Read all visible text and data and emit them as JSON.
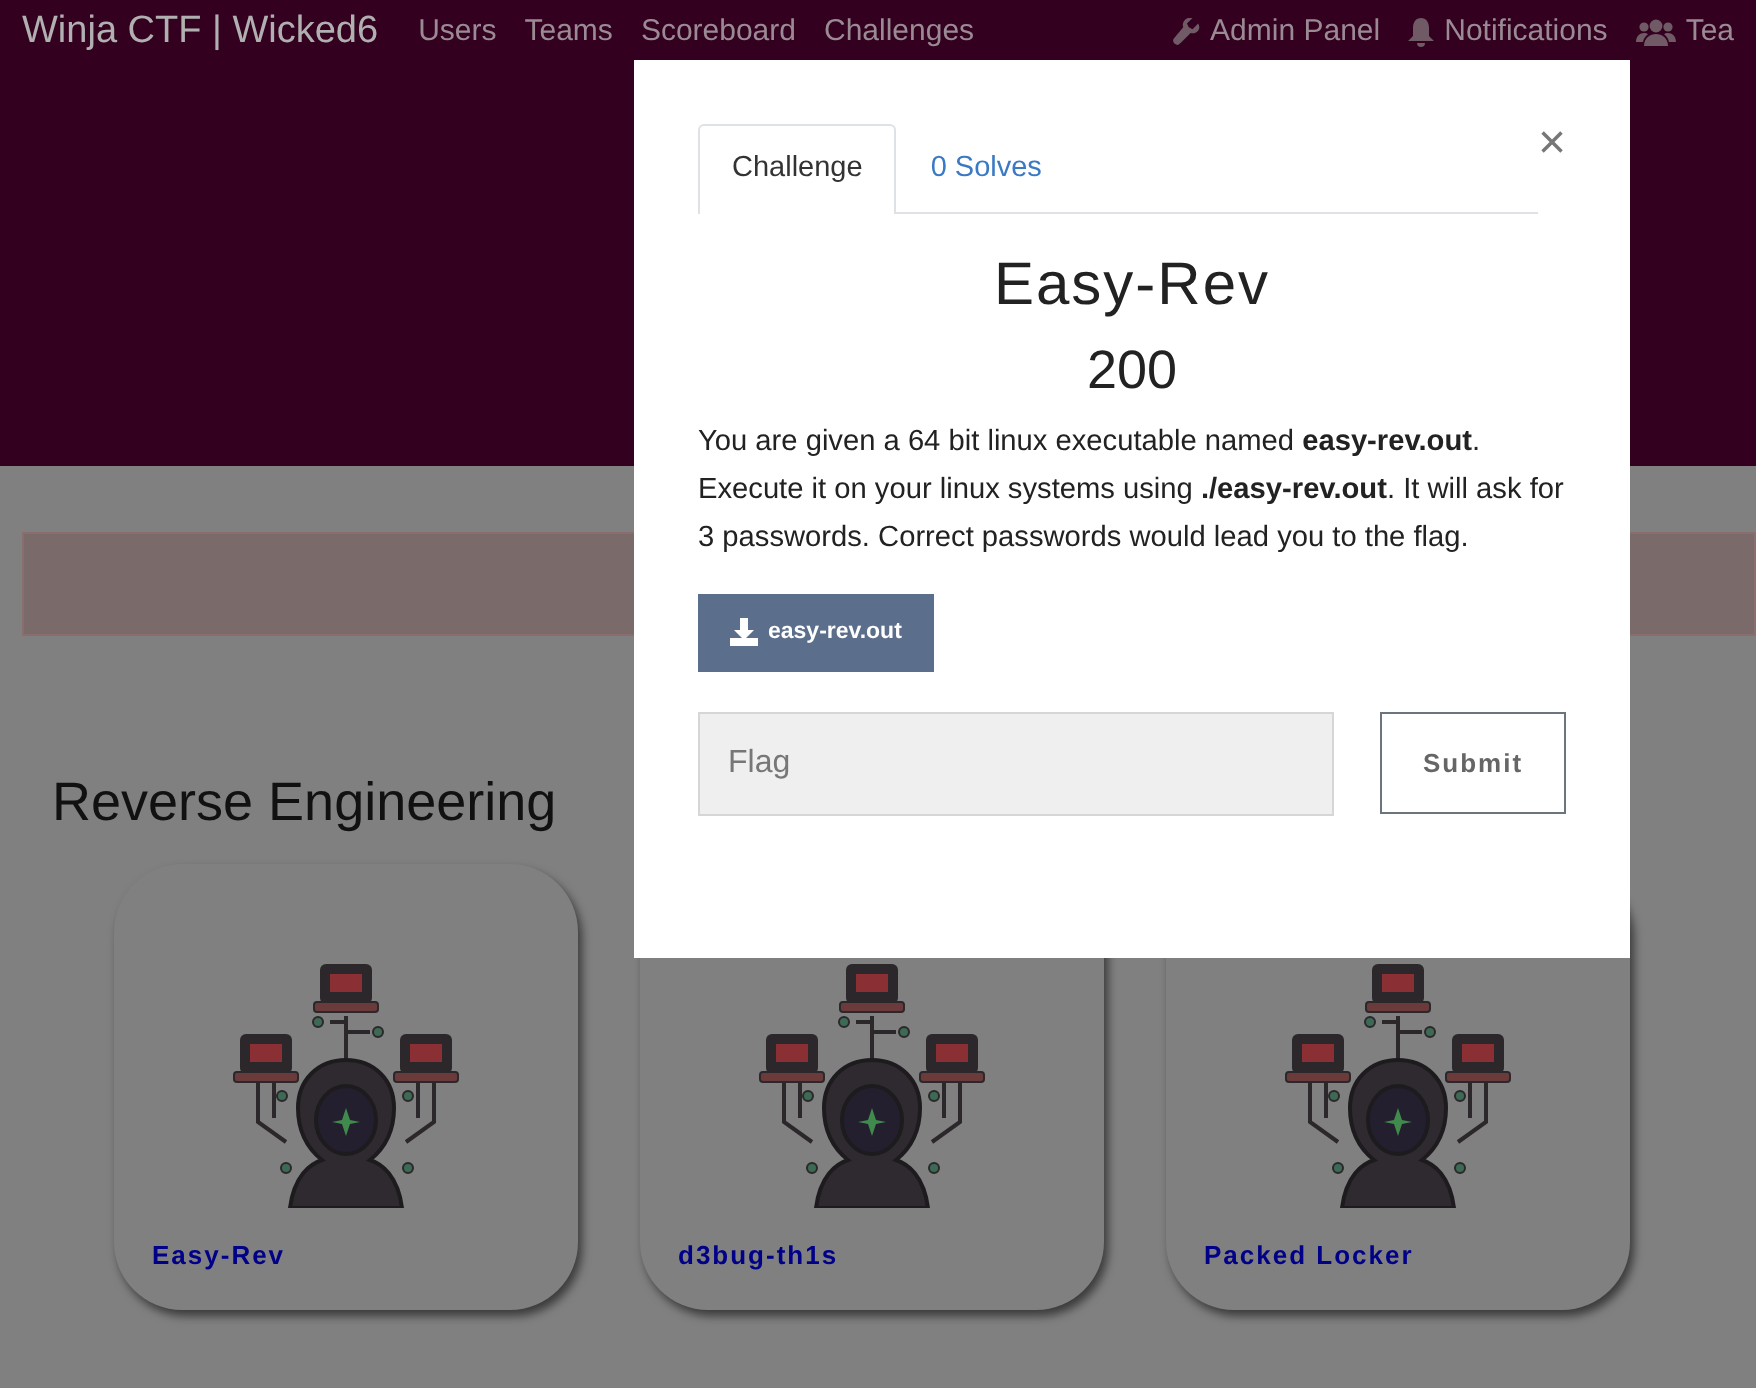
{
  "navbar": {
    "brand": "Winja CTF | Wicked6",
    "links": [
      {
        "label": "Users"
      },
      {
        "label": "Teams"
      },
      {
        "label": "Scoreboard"
      },
      {
        "label": "Challenges"
      }
    ],
    "right_links": [
      {
        "label": "Admin Panel",
        "kind": "wrench"
      },
      {
        "label": "Notifications",
        "kind": "bell"
      },
      {
        "label": "Tea",
        "kind": "users"
      }
    ]
  },
  "category": "Reverse Engineering",
  "challenges": [
    {
      "name": "Easy-Rev"
    },
    {
      "name": "d3bug-th1s"
    },
    {
      "name": "Packed Locker"
    }
  ],
  "modal": {
    "tabs": [
      {
        "label": "Challenge",
        "selected": true
      },
      {
        "label": "0 Solves",
        "selected": false
      }
    ],
    "close": "×",
    "title": "Easy-Rev",
    "value": "200",
    "description": "You are given a 64 bit linux executable named **easy-rev.out**. Execute it on your linux systems using **./easy-rev.out**. It will ask for 3 passwords. Correct passwords would lead you to the flag.",
    "download": "easy-rev.out",
    "flag": {
      "placeholder": "Flag"
    },
    "submit": "Submit"
  }
}
